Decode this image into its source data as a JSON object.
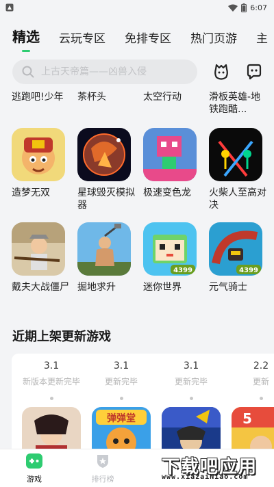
{
  "status_bar": {
    "time": "6:07",
    "icons": [
      "a-notification-icon",
      "wifi-icon",
      "battery-icon"
    ]
  },
  "tabs": [
    "精选",
    "云玩专区",
    "免排专区",
    "热门页游",
    "主"
  ],
  "search": {
    "placeholder": "上古天帝篇——凶兽入侵"
  },
  "top_row_names": [
    "逃跑吧!少年",
    "茶杯头",
    "太空行动",
    "滑板英雄-地铁跑酷..."
  ],
  "games_row1": [
    {
      "name": "造梦无双",
      "icon": "dream-warrior-icon"
    },
    {
      "name": "星球毁灭模拟器",
      "icon": "planet-destroy-icon"
    },
    {
      "name": "极速变色龙",
      "icon": "chameleon-icon"
    },
    {
      "name": "火柴人至高对决",
      "icon": "stickman-icon"
    }
  ],
  "games_row2": [
    {
      "name": "戴夫大战僵尸",
      "icon": "dave-zombie-icon"
    },
    {
      "name": "掘地求升",
      "icon": "getting-over-it-icon"
    },
    {
      "name": "迷你世界",
      "icon": "mini-world-icon",
      "badge": "4399"
    },
    {
      "name": "元气骑士",
      "icon": "soul-knight-icon",
      "badge": "4399"
    }
  ],
  "section_title": "近期上架更新游戏",
  "updates": [
    {
      "version": "3.1",
      "desc": "新版本更新完毕"
    },
    {
      "version": "3.1",
      "desc": "更新完毕"
    },
    {
      "version": "3.1",
      "desc": "更新完毕"
    },
    {
      "version": "2.2",
      "desc": "更新"
    }
  ],
  "update_thumb_labels": [
    "",
    "弹弹堂",
    "",
    "5"
  ],
  "bottom_nav": [
    {
      "label": "游戏",
      "active": true
    },
    {
      "label": "排行榜",
      "active": false
    }
  ],
  "watermark": {
    "title": "下载吧应用",
    "url": "www.xiazaiNiao.com"
  },
  "colors": {
    "accent": "#2ecc71",
    "background": "#f3f4f6"
  }
}
